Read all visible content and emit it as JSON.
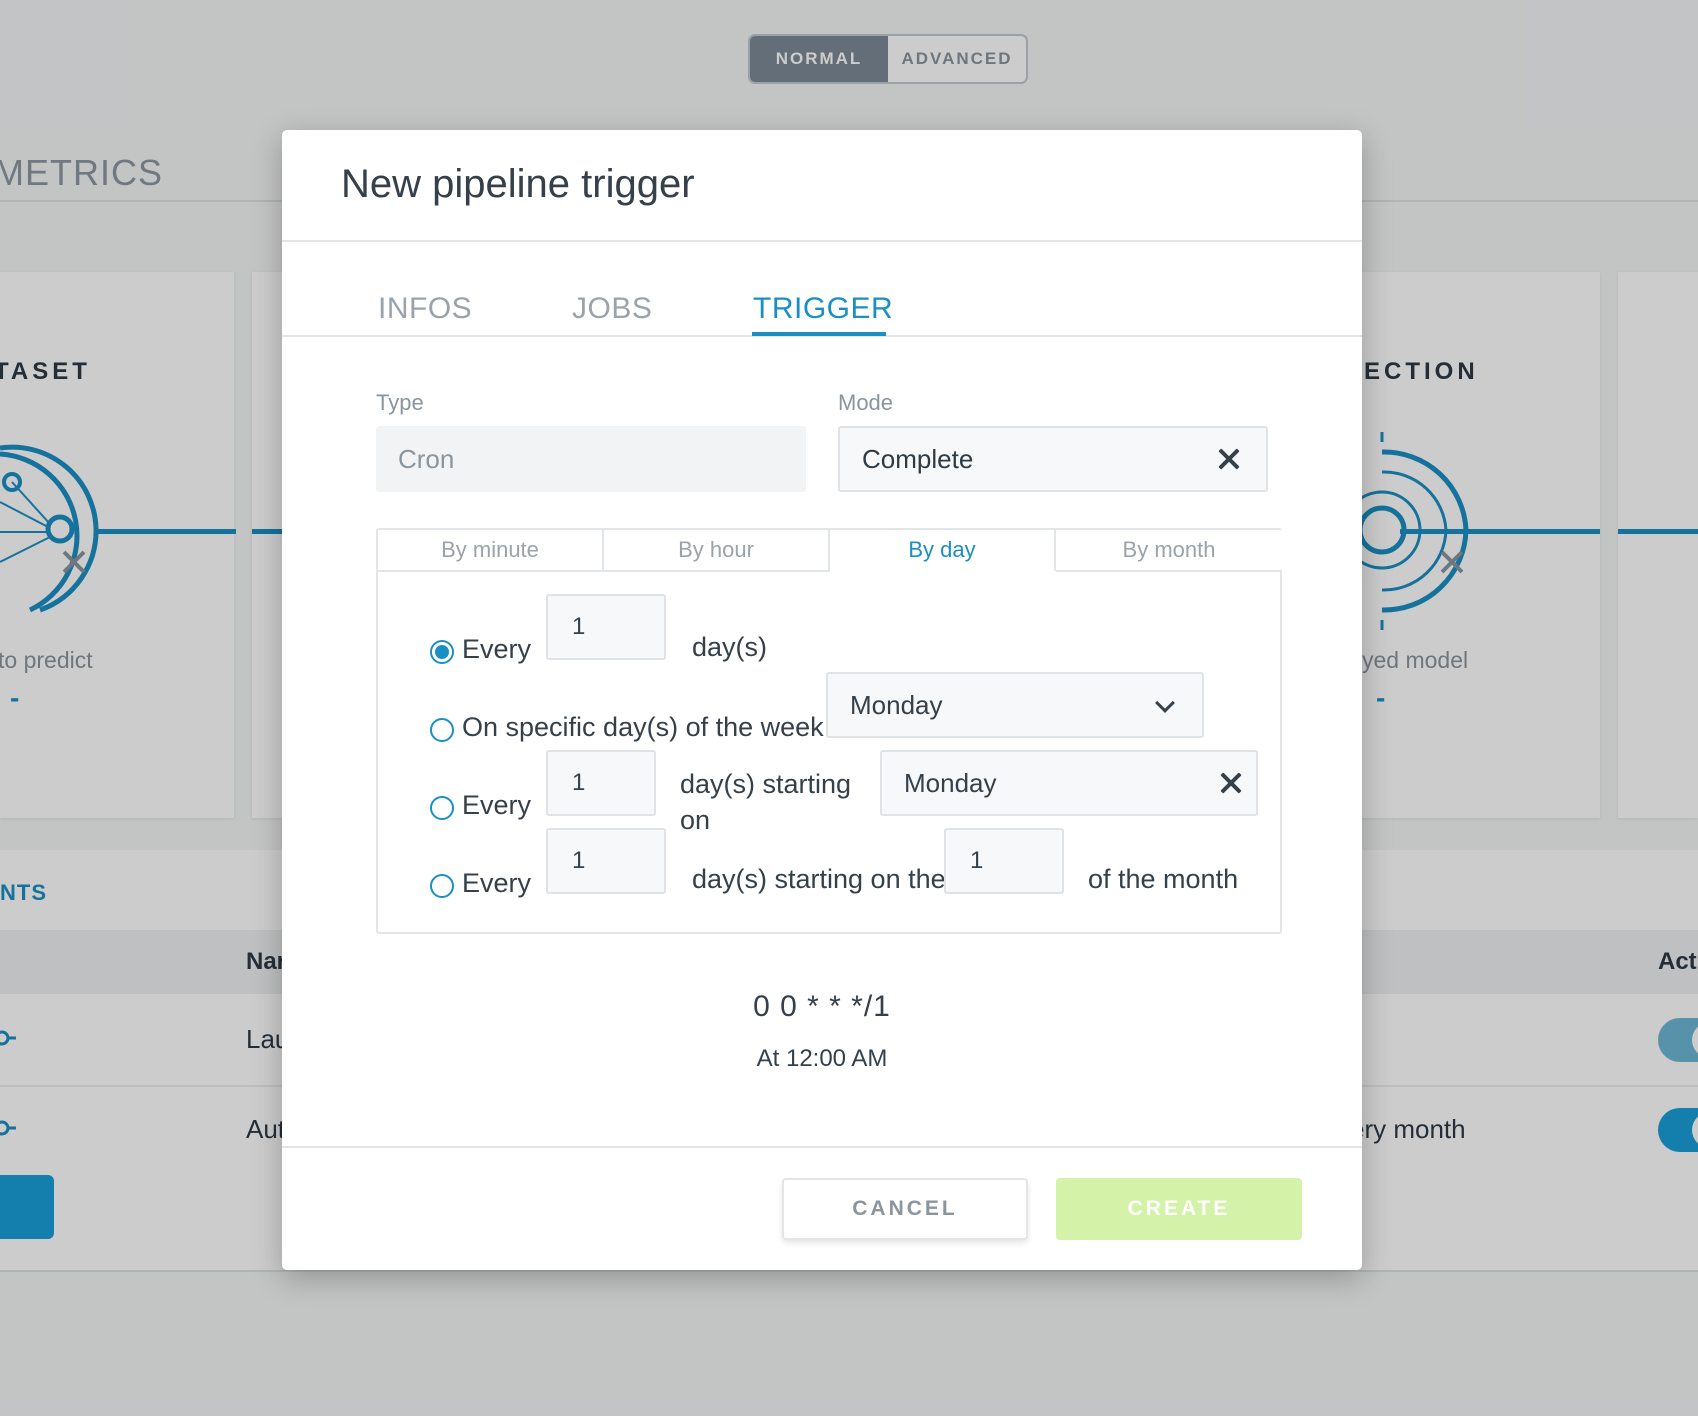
{
  "background": {
    "mode_switch": {
      "normal": "NORMAL",
      "advanced": "ADVANCED"
    },
    "metrics_title": "METRICS",
    "cards": {
      "left_title": "TASET",
      "left_sub": "to predict",
      "left_value": "-",
      "right_title": "ECTION",
      "right_sub": "yed model",
      "right_value": "-"
    },
    "events": {
      "title": "NTS",
      "col_name": "Nar",
      "col_active": "Acti",
      "rows": [
        {
          "name": "Lau",
          "schedule": ""
        },
        {
          "name": "Aut",
          "schedule": "ery month"
        }
      ]
    }
  },
  "modal": {
    "title": "New pipeline trigger",
    "tabs": [
      {
        "label": "INFOS",
        "active": false
      },
      {
        "label": "JOBS",
        "active": false
      },
      {
        "label": "TRIGGER",
        "active": true
      }
    ],
    "type": {
      "label": "Type",
      "value": "Cron"
    },
    "mode": {
      "label": "Mode",
      "value": "Complete"
    },
    "frequency_tabs": [
      {
        "label": "By minute",
        "active": false
      },
      {
        "label": "By hour",
        "active": false
      },
      {
        "label": "By day",
        "active": true
      },
      {
        "label": "By month",
        "active": false
      }
    ],
    "options": {
      "every_days": {
        "label": "Every",
        "value": "1",
        "suffix": "day(s)",
        "selected": true
      },
      "specific_weekday": {
        "label": "On specific day(s) of the week",
        "value": "Monday",
        "selected": false
      },
      "every_days_starting_weekday": {
        "label": "Every",
        "value": "1",
        "suffix": "day(s) starting on",
        "weekday": "Monday",
        "selected": false
      },
      "every_days_starting_monthday": {
        "label": "Every",
        "value": "1",
        "suffix": "day(s) starting on the",
        "day_of_month": "1",
        "tail": "of the month",
        "selected": false
      }
    },
    "cron_expression": "0 0 * * */1",
    "cron_description": "At 12:00 AM",
    "buttons": {
      "cancel": "CANCEL",
      "create": "CREATE"
    },
    "colors": {
      "accent": "#1a8fc4",
      "create_disabled": "#d4f2a8"
    }
  }
}
